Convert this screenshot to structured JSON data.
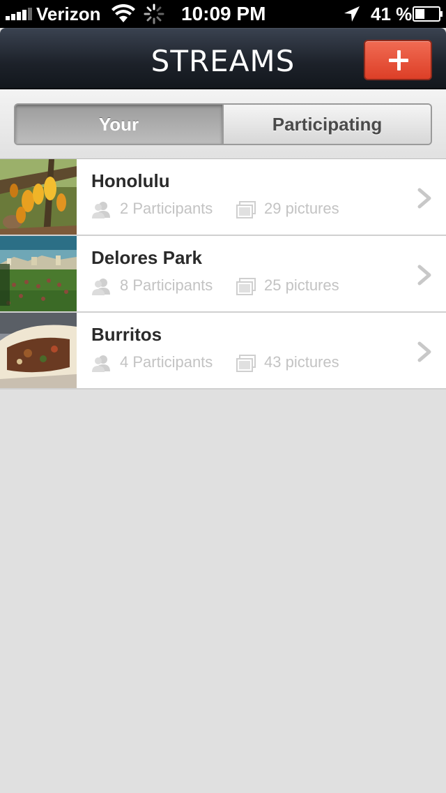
{
  "status_bar": {
    "carrier": "Verizon",
    "time": "10:09 PM",
    "battery_percent": "41 %",
    "battery_level": 0.41,
    "icons": [
      "signal-icon",
      "wifi-icon",
      "activity-spinner-icon",
      "location-arrow-icon",
      "battery-icon"
    ]
  },
  "nav": {
    "title": "STREAMS",
    "add_button_icon": "plus-icon"
  },
  "segments": {
    "your_label": "Your",
    "participating_label": "Participating",
    "selected": "Your"
  },
  "streams": [
    {
      "title": "Honolulu",
      "participants": "2 Participants",
      "pictures": "29 pictures",
      "thumbnail": "starfruit-tree-photo"
    },
    {
      "title": "Delores Park",
      "participants": "8 Participants",
      "pictures": "25 pictures",
      "thumbnail": "park-crowd-photo"
    },
    {
      "title": "Burritos",
      "participants": "4 Participants",
      "pictures": "43 pictures",
      "thumbnail": "burrito-photo"
    }
  ],
  "colors": {
    "accent": "#e24a31",
    "nav_dark": "#1c2129",
    "background": "#e0e0e0",
    "meta_text": "#c3c3c3"
  }
}
